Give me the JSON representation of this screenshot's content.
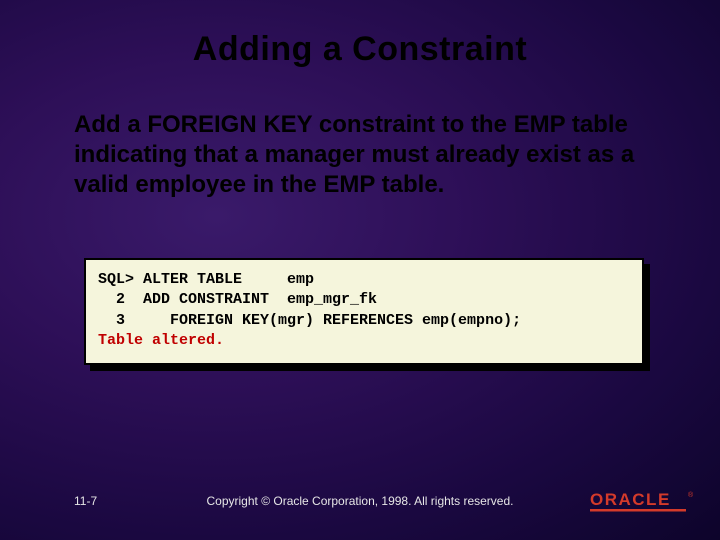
{
  "slide": {
    "title": "Adding a Constraint",
    "body": "Add a FOREIGN KEY constraint to the EMP table indicating that a manager must already exist as a valid employee in the EMP table.",
    "code": {
      "line1": "SQL> ALTER TABLE     emp",
      "line2": "  2  ADD CONSTRAINT  emp_mgr_fk",
      "line3": "  3     FOREIGN KEY(mgr) REFERENCES emp(empno);",
      "result": "Table altered."
    }
  },
  "footer": {
    "page": "11-7",
    "copyright": "Copyright © Oracle Corporation, 1998. All rights reserved.",
    "logo_text": "ORACLE"
  }
}
